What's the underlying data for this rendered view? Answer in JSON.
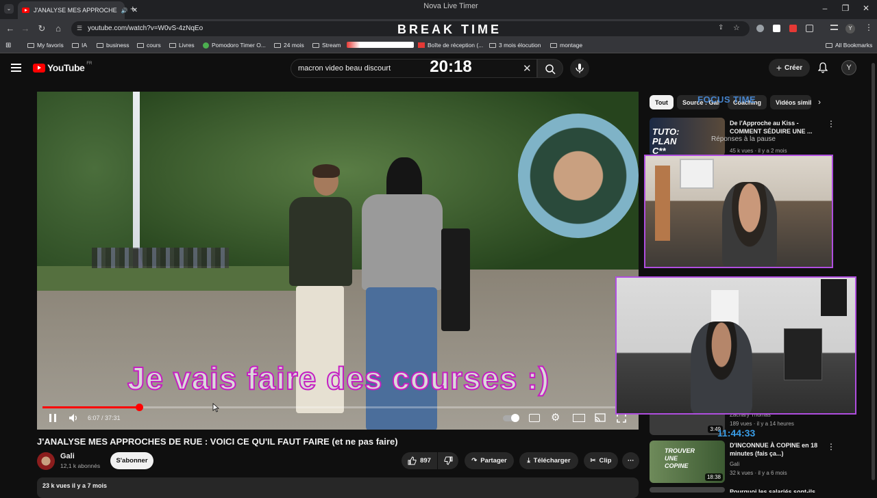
{
  "window": {
    "title": "Nova Live Timer",
    "overlay_banner": "BREAK TIME",
    "overlay_timer": "20:18"
  },
  "browser": {
    "tab_title": "J'ANALYSE MES APPROCHE",
    "url": "youtube.com/watch?v=W0vS-4zNqEo",
    "bookmarks": [
      "My favoris",
      "IA",
      "business",
      "cours",
      "Livres",
      "Pomodoro Timer O...",
      "24 mois",
      "Stream",
      "Boîte de réception (...",
      "3 mois élocution",
      "montage"
    ],
    "all_bookmarks": "All Bookmarks"
  },
  "youtube": {
    "logo": "YouTube",
    "logo_region": "FR",
    "search_value": "macron video beau discourt",
    "create_label": "Créer",
    "avatar_letter": "Y"
  },
  "player": {
    "subtitle": "Je vais faire des courses :)",
    "current_time": "6:07",
    "duration": "37:31",
    "time_display": "6:07 / 37:31",
    "progress": 0.1635
  },
  "video": {
    "title": "J'ANALYSE MES APPROCHES DE RUE : VOICI CE QU'IL FAUT FAIRE (et ne pas faire)",
    "channel": "Gali",
    "subscribers": "12,1 k abonnés",
    "subscribe_label": "S'abonner",
    "likes": "897",
    "share_label": "Partager",
    "download_label": "Télécharger",
    "clip_label": "Clip",
    "views_date": "23 k vues  il y a 7 mois"
  },
  "sidebar": {
    "chips": [
      "Tout",
      "Source : Gali",
      "Coaching",
      "Vidéos similaires"
    ],
    "recommendations": [
      {
        "title": "De l'Approche au Kiss - COMMENT SÉDUIRE UNE ...",
        "channel": "Gali",
        "meta": "45 k vues · il y a 2 mois",
        "thumb_text": "TUTO: PLAN C**"
      },
      {
        "title": "",
        "channel": "Zachary Thomas",
        "meta": "189 vues · il y a 14 heures",
        "duration": "3:49"
      },
      {
        "title": "D'INCONNUE À COPINE en 18 minutes (fais ça...)",
        "channel": "Gali",
        "meta": "32 k vues · il y a 6 mois",
        "duration": "18:38",
        "thumb_text": "TROUVER UNE COPINE"
      },
      {
        "title": "Pourquoi les salariés sont-ils",
        "channel": "",
        "meta": ""
      }
    ]
  },
  "overlays": {
    "focus_logo": "FOCUS TIME",
    "pause_text": "Réponses à la pause",
    "focus_timer": "11:44:33"
  },
  "colors": {
    "accent_red": "#ff0000",
    "overlay_purple": "#b04ee0",
    "focus_blue": "#3a9ee8"
  }
}
